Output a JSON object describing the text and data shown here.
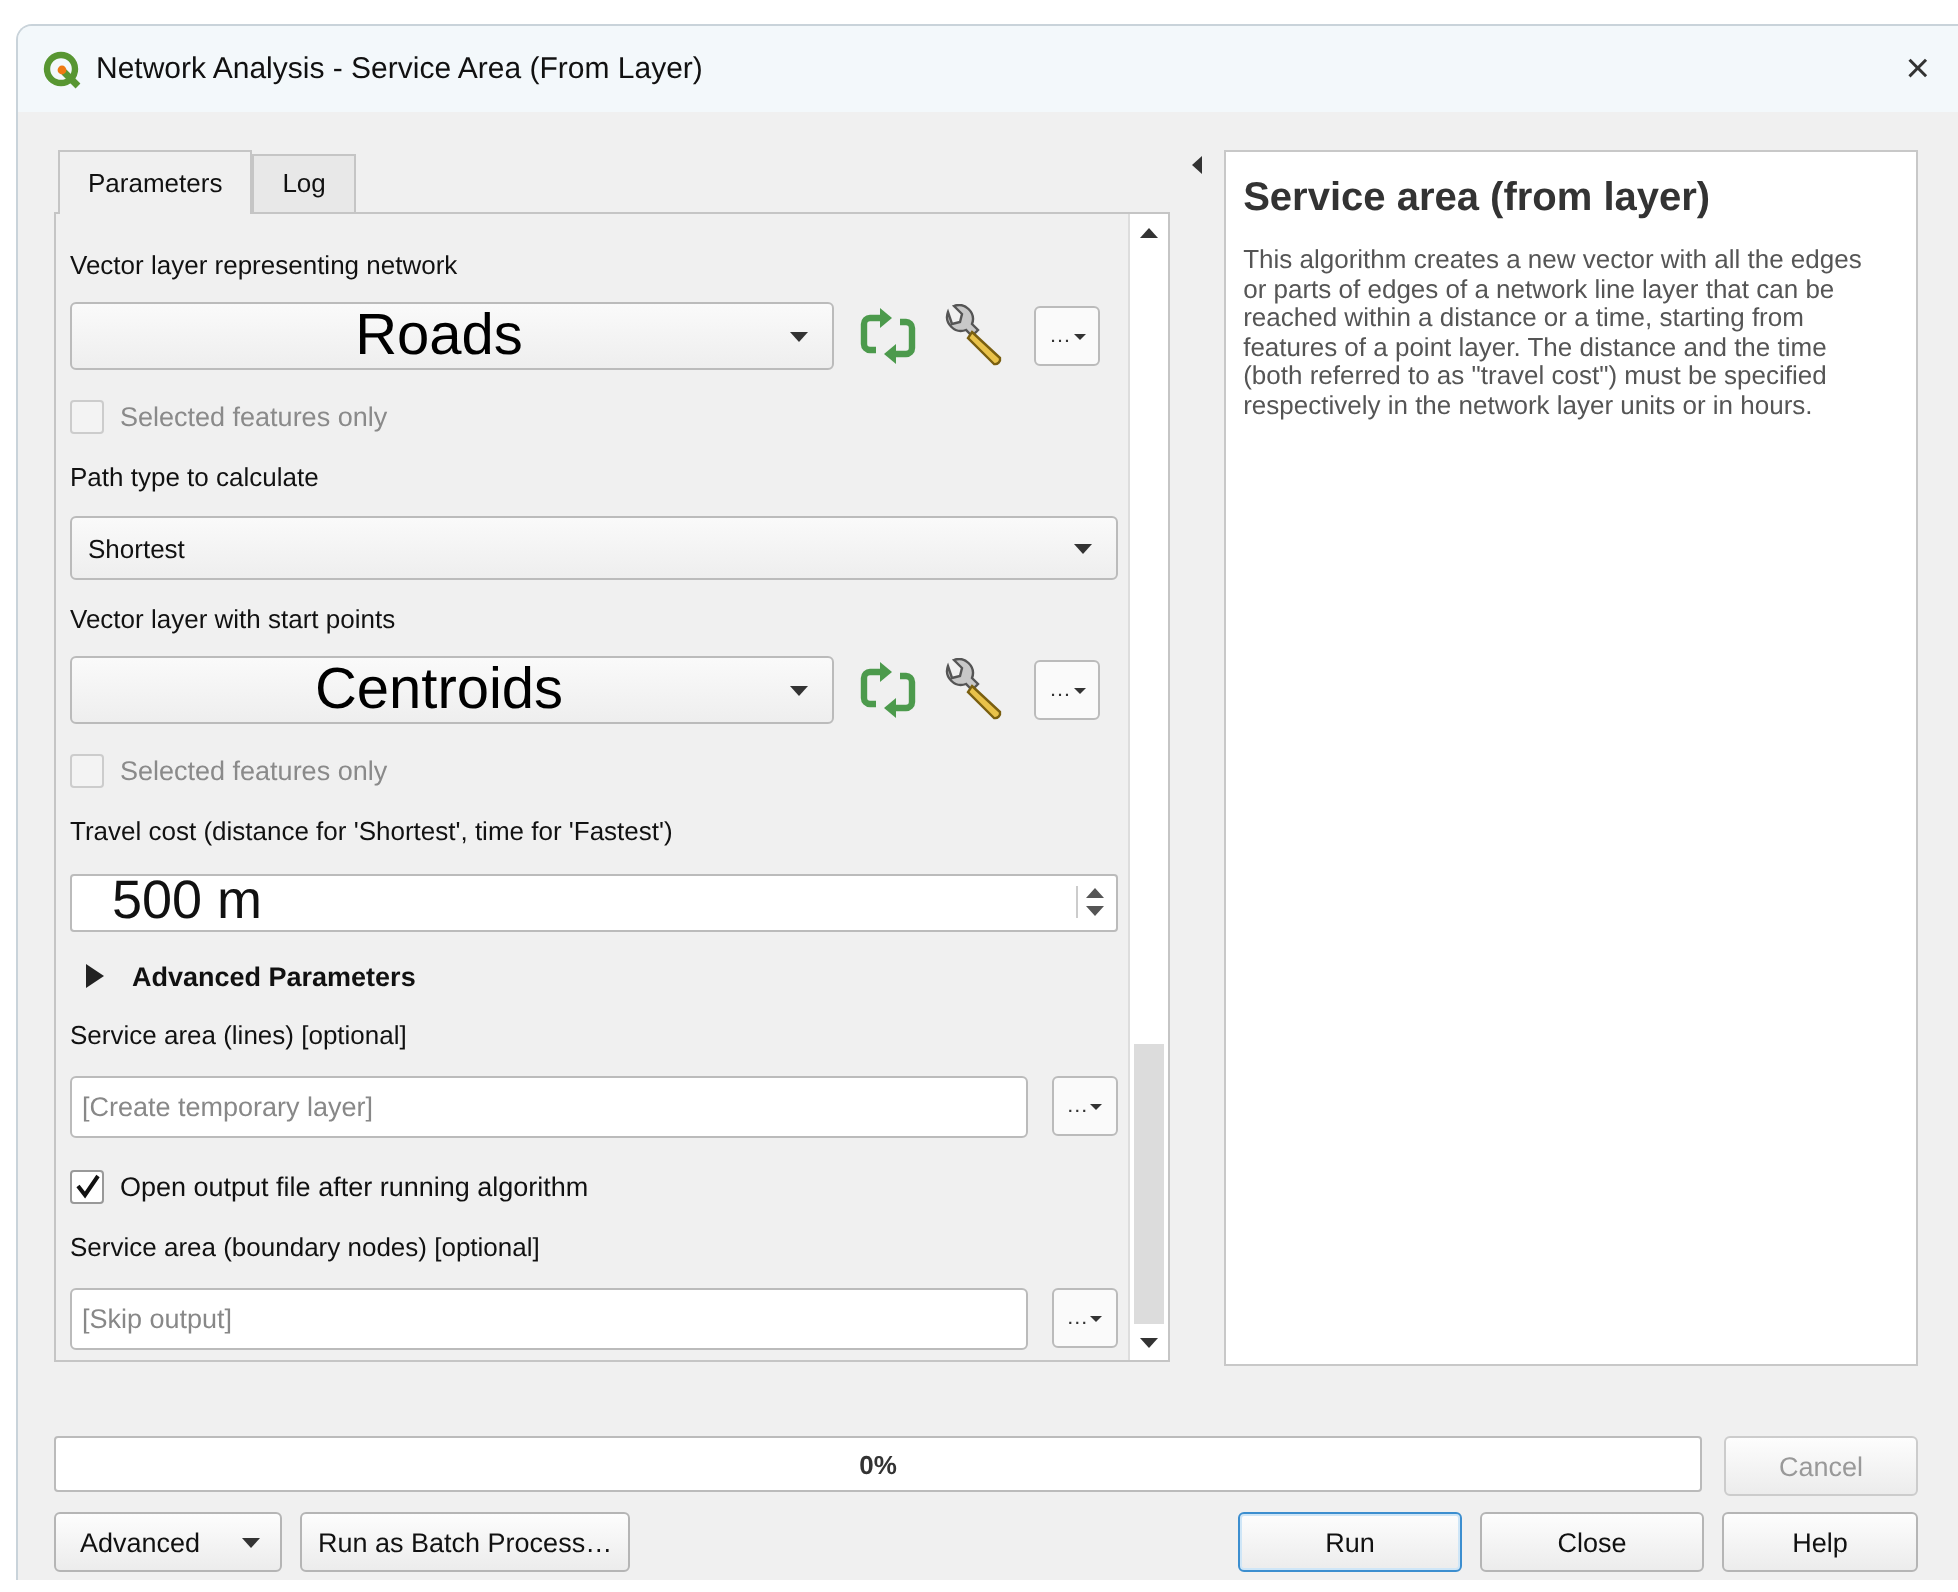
{
  "window": {
    "title": "Network Analysis - Service Area (From Layer)",
    "close": "×"
  },
  "tabs": [
    {
      "label": "Parameters",
      "selected": true
    },
    {
      "label": "Log",
      "selected": false
    }
  ],
  "params": [
    {
      "kind": "label",
      "text": "Vector layer representing network"
    },
    {
      "kind": "layer_combo",
      "value": "Roads",
      "button": "…"
    },
    {
      "kind": "checkbox",
      "label": "Selected features only",
      "checked": false,
      "disabled": true
    },
    {
      "kind": "label",
      "text": "Path type to calculate"
    },
    {
      "kind": "combo",
      "value": "Shortest"
    },
    {
      "kind": "label",
      "text": "Vector layer with start points"
    },
    {
      "kind": "layer_combo",
      "value": "Centroids",
      "button": "…"
    },
    {
      "kind": "checkbox",
      "label": "Selected features only",
      "checked": false,
      "disabled": true
    },
    {
      "kind": "label",
      "text": "Travel cost (distance for 'Shortest', time for 'Fastest')"
    },
    {
      "kind": "spin",
      "value": "500 m"
    },
    {
      "kind": "section",
      "label": "Advanced Parameters",
      "expanded": false
    },
    {
      "kind": "label",
      "text": "Service area (lines) [optional]"
    },
    {
      "kind": "output",
      "placeholder": "[Create temporary layer]",
      "button": "…"
    },
    {
      "kind": "checkbox",
      "label": "Open output file after running algorithm",
      "checked": true,
      "disabled": false
    },
    {
      "kind": "label",
      "text": "Service area (boundary nodes) [optional]"
    },
    {
      "kind": "output",
      "placeholder": "[Skip output]",
      "button": "…"
    }
  ],
  "help": {
    "title": "Service area (from layer)",
    "text": "This algorithm creates a new vector with all the edges or parts of edges of a network line layer that can be reached within a distance or a time, starting from features of a point layer. The distance and the time (both referred to as \"travel cost\") must be specified respectively in the network layer units or in hours."
  },
  "progress": {
    "level": 0,
    "text": "0%"
  },
  "cancel": {
    "label": "Cancel",
    "disabled": true
  },
  "left_buttons": [
    {
      "label": "Advanced",
      "kind": "menu"
    },
    {
      "label": "Run as Batch Process…",
      "kind": "plain"
    }
  ],
  "right_buttons": [
    {
      "label": "Run",
      "default": true
    },
    {
      "label": "Close",
      "default": false
    },
    {
      "label": "Help",
      "default": false
    }
  ]
}
